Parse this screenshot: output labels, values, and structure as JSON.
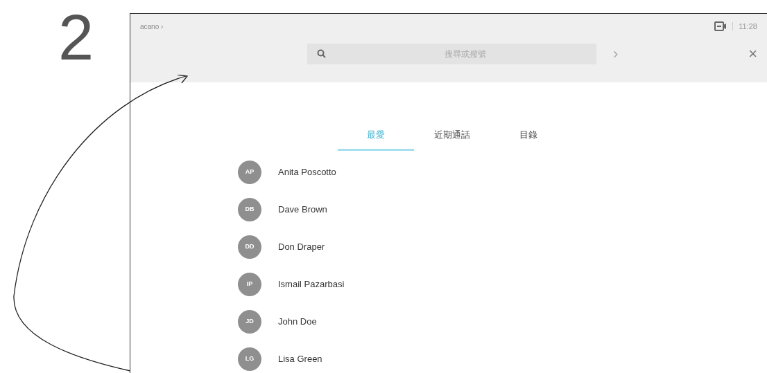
{
  "step_number": "2",
  "header": {
    "breadcrumb": "acano ›",
    "time": "11:28",
    "search": {
      "placeholder": "搜尋或撥號"
    },
    "next": "›",
    "close": "×"
  },
  "tabs": [
    {
      "label": "最愛",
      "selected": true
    },
    {
      "label": "近期通話",
      "selected": false
    },
    {
      "label": "目錄",
      "selected": false
    }
  ],
  "contacts": [
    {
      "initials": "AP",
      "name": "Anita Poscotto"
    },
    {
      "initials": "DB",
      "name": "Dave Brown"
    },
    {
      "initials": "DD",
      "name": "Don Draper"
    },
    {
      "initials": "IP",
      "name": "Ismail Pazarbasi"
    },
    {
      "initials": "JD",
      "name": "John Doe"
    },
    {
      "initials": "LG",
      "name": "Lisa Green"
    }
  ]
}
